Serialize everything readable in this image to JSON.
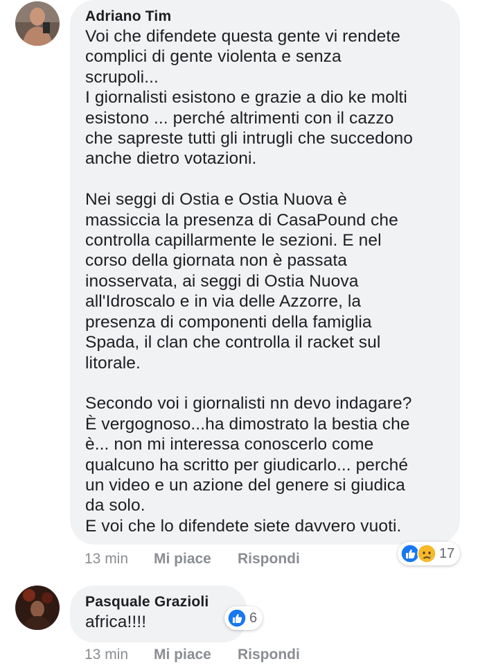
{
  "comments": [
    {
      "author": "Adriano Tim",
      "text": "Voi che difendete questa gente vi rendete\ncomplici di gente violenta e senza\nscrupoli...\nI giornalisti esistono e grazie a dio ke molti\nesistono ... perché altrimenti con il cazzo\nche sapreste tutti gli intrugli che succedono\nanche dietro votazioni.\n\nNei seggi di Ostia e Ostia Nuova è\nmassiccia la presenza di CasaPound che\ncontrolla capillarmente le sezioni. E nel\ncorso della giornata non è passata\ninosservata, ai seggi di Ostia Nuova\nall'Idroscalo e in via delle Azzorre, la\npresenza di componenti della famiglia\nSpada, il clan che controlla il racket sul\nlitorale.\n\nSecondo voi i giornalisti nn devo indagare?\nÈ vergognoso...ha dimostrato la bestia che\nè... non mi interessa conoscerlo come\nqualcuno ha scritto per giudicarlo... perché\nun video e un azione del genere si giudica\nda solo.\nE voi che lo difendete siete davvero vuoti.",
      "time": "13 min",
      "like_label": "Mi piace",
      "reply_label": "Rispondi",
      "reactions": {
        "icons": [
          "like-icon",
          "sad-icon"
        ],
        "count": "17"
      }
    },
    {
      "author": "Pasquale Grazioli",
      "text": "africa!!!!",
      "time": "13 min",
      "like_label": "Mi piace",
      "reply_label": "Rispondi",
      "reactions": {
        "icons": [
          "like-icon"
        ],
        "count": "6"
      }
    }
  ],
  "colors": {
    "bubble": "#f1f2f4",
    "text": "#1c1e21",
    "meta": "#8a8d91",
    "like_blue": "#1877f2",
    "sad_yellow": "#f7b928"
  }
}
